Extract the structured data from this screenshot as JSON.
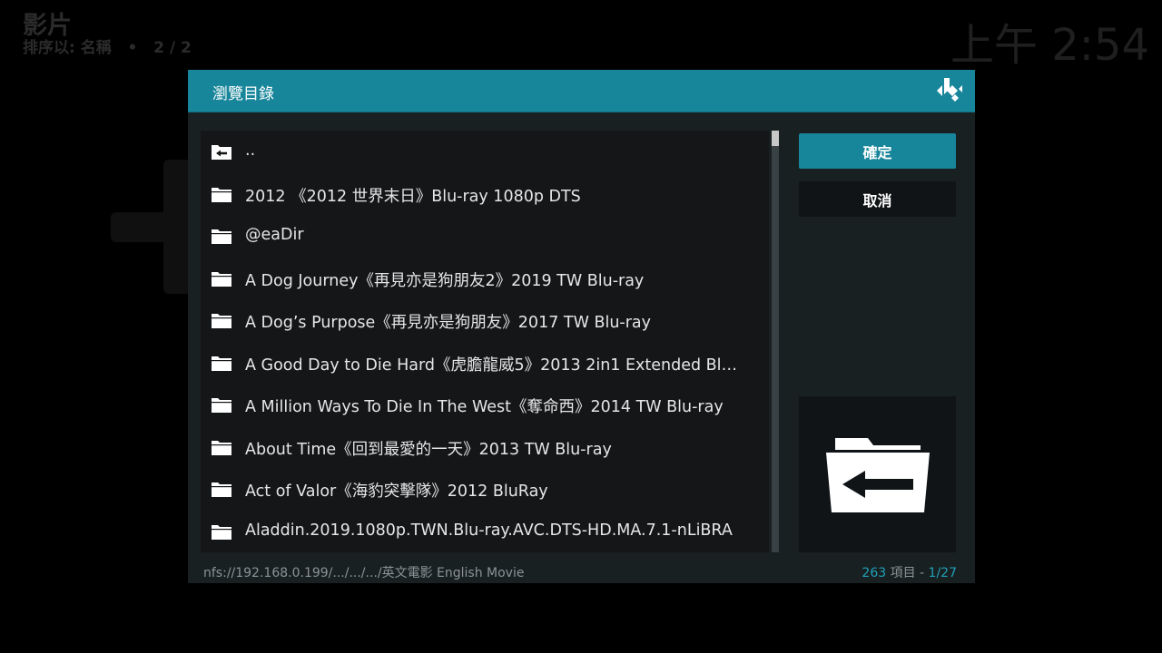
{
  "background": {
    "window_title": "影片",
    "sort_label": "排序以: 名稱",
    "sort_separator": "•",
    "page_indicator": "2 / 2",
    "clock": "上午 2:54"
  },
  "dialog": {
    "title": "瀏覽目錄",
    "items": [
      {
        "label": "..",
        "icon": "folder-back-icon"
      },
      {
        "label": "2012 《2012 世界末日》Blu-ray 1080p DTS",
        "icon": "folder-icon"
      },
      {
        "label": "@eaDir",
        "icon": "folder-icon"
      },
      {
        "label": "A Dog Journey《再見亦是狗朋友2》2019 TW Blu-ray",
        "icon": "folder-icon"
      },
      {
        "label": "A Dog’s Purpose《再見亦是狗朋友》2017 TW Blu-ray",
        "icon": "folder-icon"
      },
      {
        "label": "A Good Day to Die Hard《虎膽龍威5》2013 2in1 Extended Bl…",
        "icon": "folder-icon"
      },
      {
        "label": "A Million Ways To Die In The West《奪命西》2014 TW Blu-ray",
        "icon": "folder-icon"
      },
      {
        "label": "About Time《回到最愛的一天》2013 TW Blu-ray",
        "icon": "folder-icon"
      },
      {
        "label": "Act of Valor《海豹突擊隊》2012 BluRay",
        "icon": "folder-icon"
      },
      {
        "label": "Aladdin.2019.1080p.TWN.Blu-ray.AVC.DTS-HD.MA.7.1-nLiBRA",
        "icon": "folder-icon"
      }
    ],
    "ok_label": "確定",
    "cancel_label": "取消",
    "preview_icon": "folder-back-icon",
    "path": "nfs://192.168.0.199/.../.../.../英文電影 English Movie",
    "count_number": "263",
    "count_label": " 項目 - ",
    "count_page": "1/27"
  },
  "colors": {
    "accent": "#17859a",
    "dialog_bg": "#192022",
    "list_bg": "#141618"
  }
}
